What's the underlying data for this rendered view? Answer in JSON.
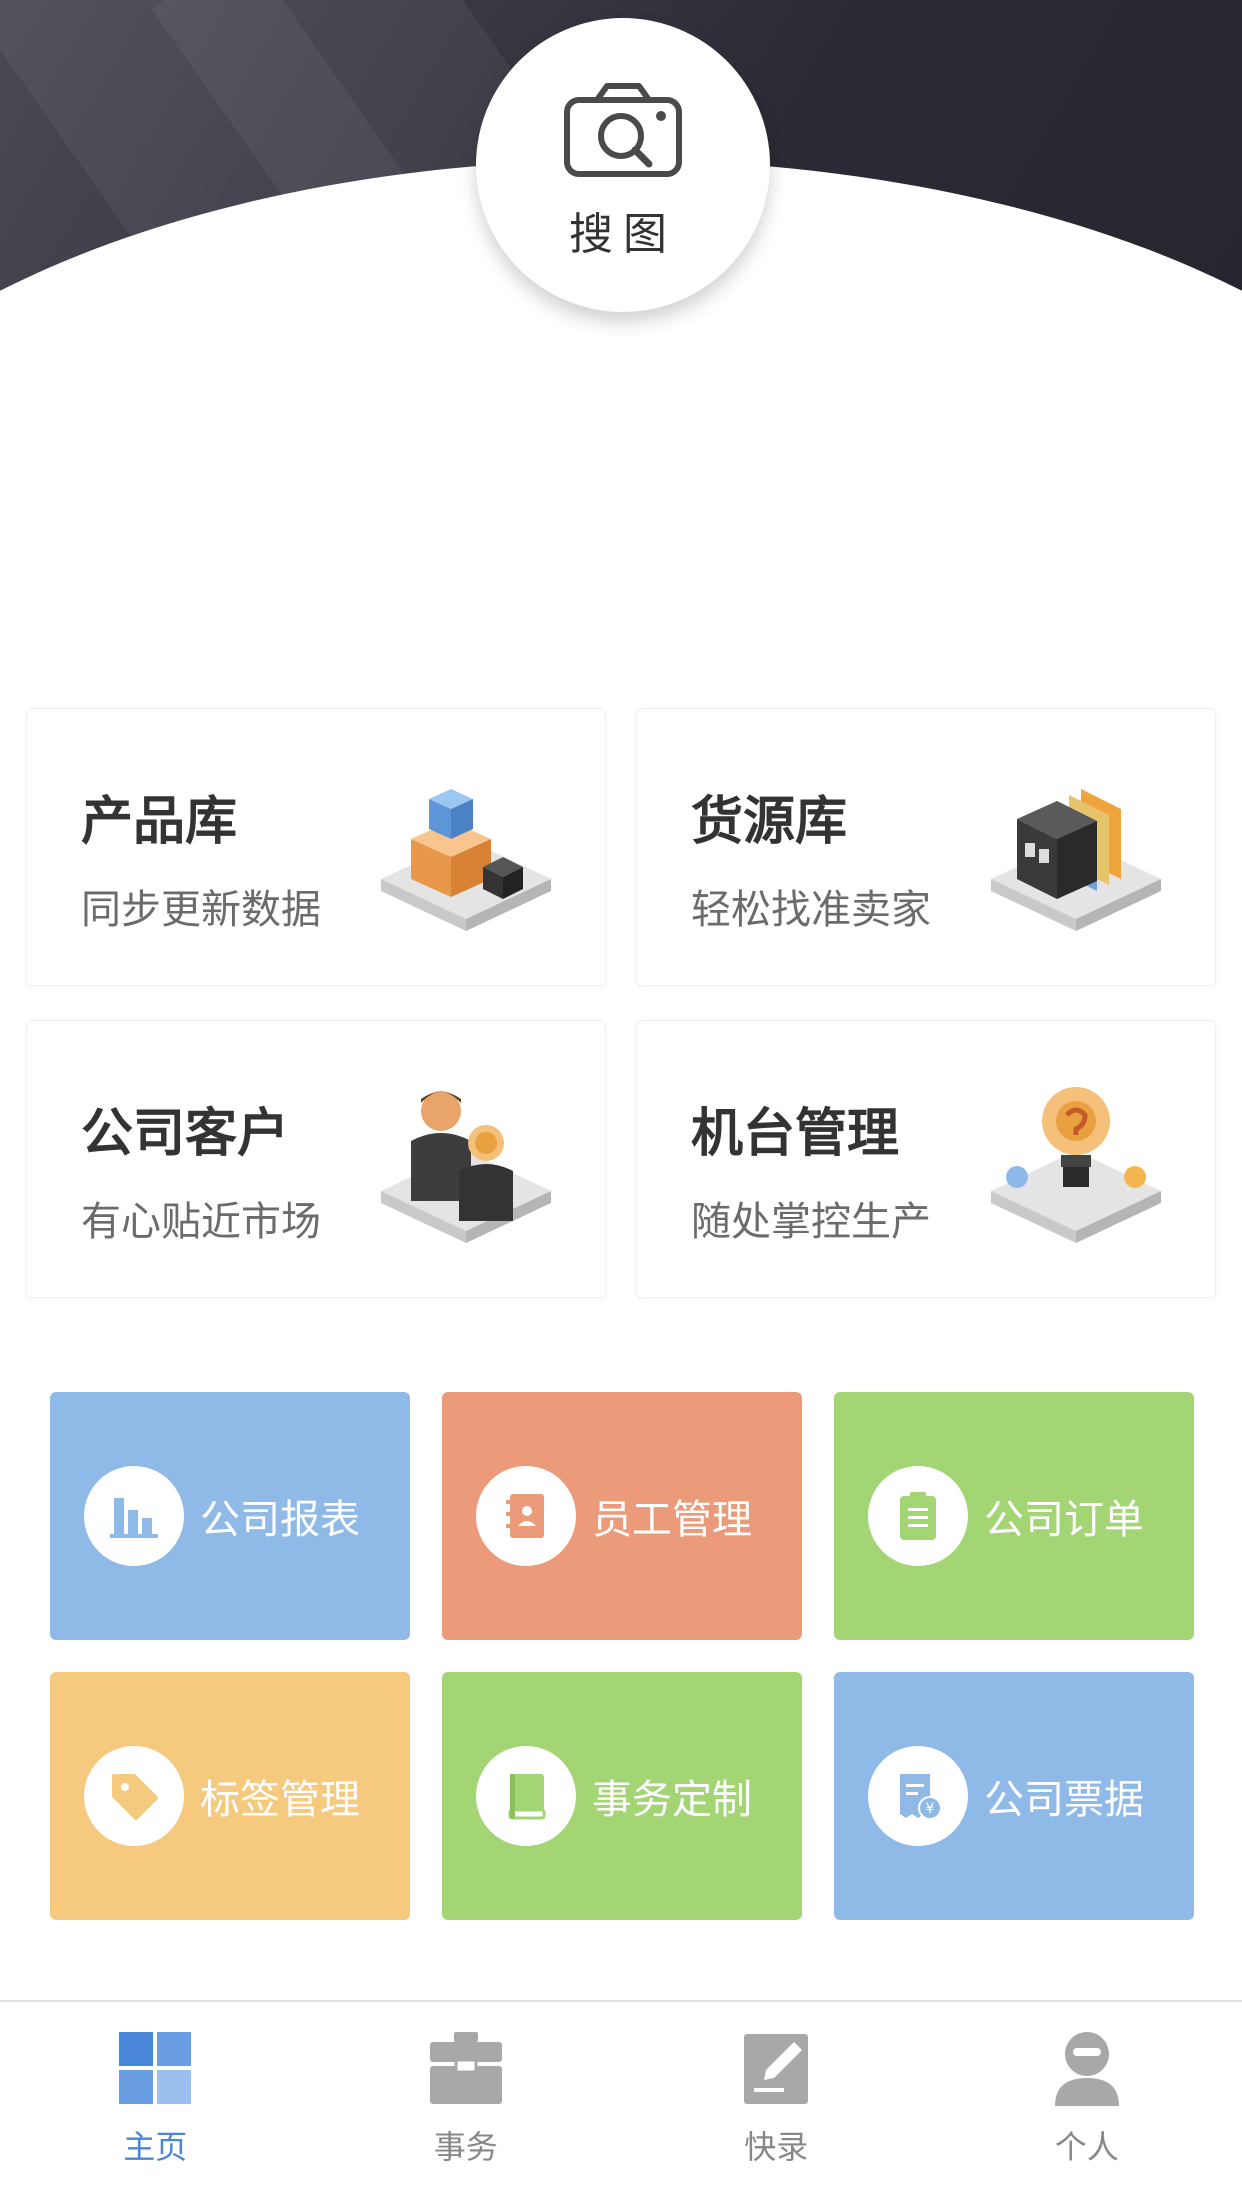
{
  "header": {
    "search_label": "搜图",
    "search_icon": "camera-search-icon"
  },
  "cards": [
    {
      "title": "产品库",
      "subtitle": "同步更新数据",
      "icon": "boxes-illustration"
    },
    {
      "title": "货源库",
      "subtitle": "轻松找准卖家",
      "icon": "folders-illustration"
    },
    {
      "title": "公司客户",
      "subtitle": "有心贴近市场",
      "icon": "people-illustration"
    },
    {
      "title": "机台管理",
      "subtitle": "随处掌控生产",
      "icon": "lightbulb-illustration"
    }
  ],
  "tiles": [
    {
      "label": "公司报表",
      "icon": "bar-chart-icon",
      "color": "#8fbae8"
    },
    {
      "label": "员工管理",
      "icon": "contact-book-icon",
      "color": "#ec9b7a"
    },
    {
      "label": "公司订单",
      "icon": "clipboard-icon",
      "color": "#a3d574"
    },
    {
      "label": "标签管理",
      "icon": "tag-icon",
      "color": "#f5c97e"
    },
    {
      "label": "事务定制",
      "icon": "book-icon",
      "color": "#a3d574"
    },
    {
      "label": "公司票据",
      "icon": "receipt-icon",
      "color": "#8fbae8"
    }
  ],
  "nav": {
    "items": [
      {
        "label": "主页",
        "icon": "grid-icon",
        "active": true
      },
      {
        "label": "事务",
        "icon": "briefcase-icon",
        "active": false
      },
      {
        "label": "快录",
        "icon": "note-edit-icon",
        "active": false
      },
      {
        "label": "个人",
        "icon": "person-icon",
        "active": false
      }
    ],
    "active_color": "#4a86d8",
    "inactive_color": "#888888"
  }
}
